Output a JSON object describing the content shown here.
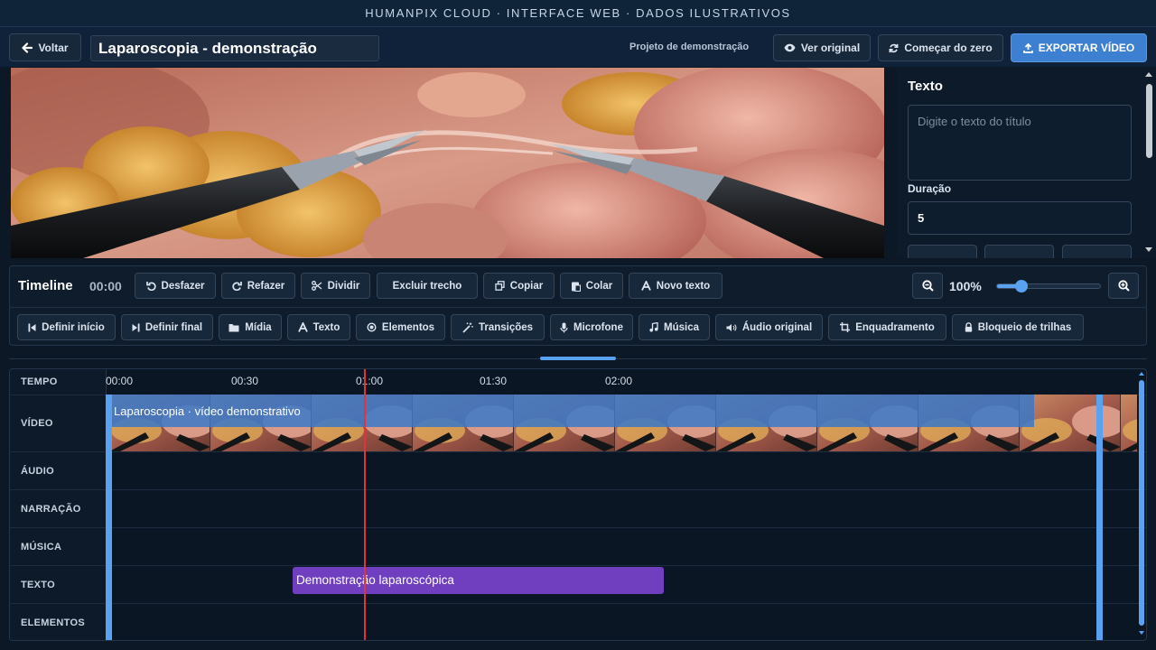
{
  "banner": "HUMANPIX CLOUD · INTERFACE WEB · DADOS ILUSTRATIVOS",
  "header": {
    "back_label": "Voltar",
    "project_title": "Laparoscopia - demonstração",
    "project_label": "Projeto de demonstração",
    "view_original_label": "Ver original",
    "restart_label": "Começar do zero",
    "export_label": "EXPORTAR VÍDEO"
  },
  "side_panel": {
    "title": "Texto",
    "text_placeholder": "Digite o texto do título",
    "duration_label": "Duração",
    "duration_value": "5"
  },
  "toolbar": {
    "title": "Timeline",
    "current_time": "00:00",
    "row1": [
      {
        "label": "Desfazer",
        "icon": "undo-icon"
      },
      {
        "label": "Refazer",
        "icon": "redo-icon"
      },
      {
        "label": "Dividir",
        "icon": "scissors-icon"
      },
      {
        "label": "Excluir trecho",
        "icon": "none"
      },
      {
        "label": "Copiar",
        "icon": "copy-icon"
      },
      {
        "label": "Colar",
        "icon": "paste-icon"
      },
      {
        "label": "Novo texto",
        "icon": "text-a-icon"
      }
    ],
    "zoom_percent": "100%",
    "zoom_level": 0.2,
    "row2": [
      {
        "label": "Definir início",
        "icon": "mark-start-icon"
      },
      {
        "label": "Definir final",
        "icon": "mark-end-icon"
      },
      {
        "label": "Mídia",
        "icon": "folder-icon"
      },
      {
        "label": "Texto",
        "icon": "text-a-icon"
      },
      {
        "label": "Elementos",
        "icon": "elements-icon"
      },
      {
        "label": "Transições",
        "icon": "magic-wand-icon"
      },
      {
        "label": "Microfone",
        "icon": "microphone-icon"
      },
      {
        "label": "Música",
        "icon": "music-note-icon"
      },
      {
        "label": "Áudio original",
        "icon": "speaker-icon"
      },
      {
        "label": "Enquadramento",
        "icon": "crop-icon"
      },
      {
        "label": "Bloqueio de trilhas",
        "icon": "lock-icon"
      }
    ]
  },
  "timeline": {
    "ruler_label": "TEMPO",
    "ticks": [
      "00:00",
      "00:30",
      "01:00",
      "01:30",
      "02:00"
    ],
    "tracks": [
      "VÍDEO",
      "ÁUDIO",
      "NARRAÇÃO",
      "MÚSICA",
      "TEXTO",
      "ELEMENTOS"
    ],
    "video_clip_label": "Laparoscopia · vídeo demonstrativo",
    "text_clip_label": "Demonstração laparoscópica"
  },
  "colors": {
    "accent": "#3d7fd0",
    "playhead": "#e0333a",
    "text_clip": "#6f3fbf",
    "video_clip": "#3a78c8"
  }
}
